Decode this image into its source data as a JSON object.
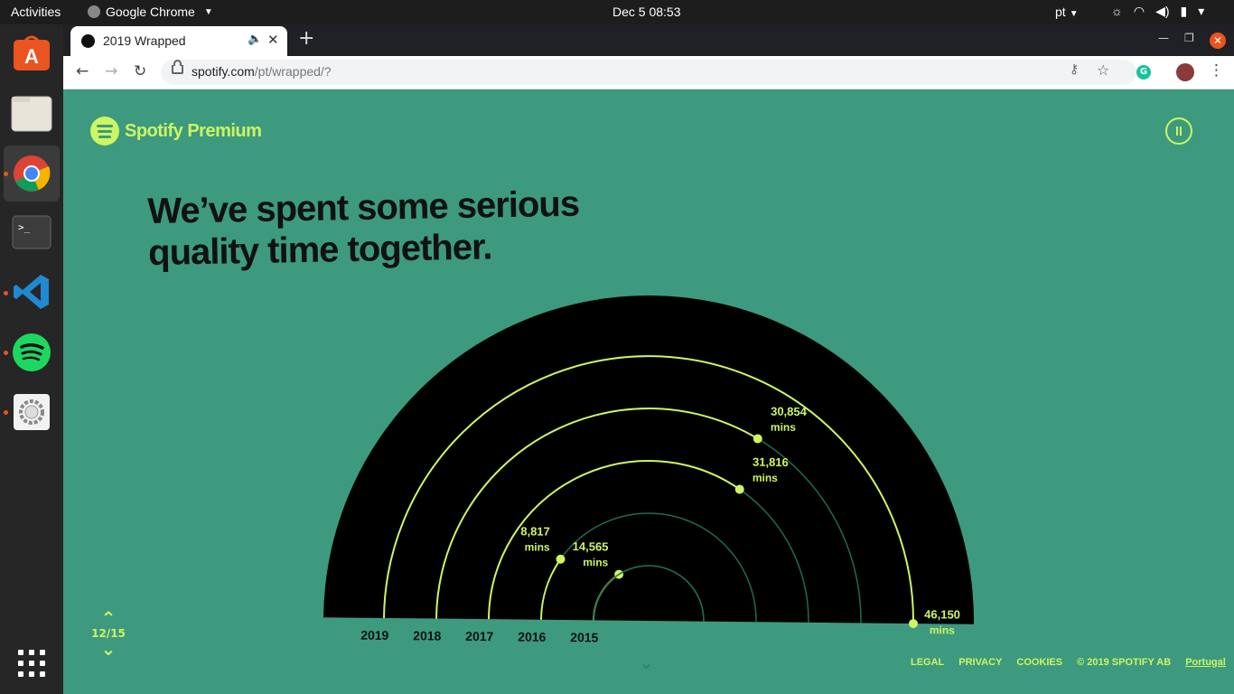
{
  "system_bar": {
    "activities": "Activities",
    "app_name": "Google Chrome",
    "clock": "Dec 5  08:53",
    "input_lang": "pt"
  },
  "dock": {
    "apps": [
      {
        "name": "Ubuntu Software",
        "icon": "software-store-icon",
        "running": false
      },
      {
        "name": "Files",
        "icon": "files-icon",
        "running": false
      },
      {
        "name": "Google Chrome",
        "icon": "chrome-icon",
        "running": true
      },
      {
        "name": "Terminal",
        "icon": "terminal-icon",
        "running": false
      },
      {
        "name": "Visual Studio Code",
        "icon": "vscode-icon",
        "running": true
      },
      {
        "name": "Spotify",
        "icon": "spotify-icon",
        "running": true
      },
      {
        "name": "Settings",
        "icon": "settings-icon",
        "running": true
      }
    ]
  },
  "browser": {
    "tab_title": "2019 Wrapped",
    "url_host": "spotify.com",
    "url_path": "/pt/wrapped/?"
  },
  "page": {
    "brand": "Spotify Premium",
    "headline_line1": "We’ve spent some serious",
    "headline_line2": "quality time together.",
    "pager": "12/15",
    "footer": {
      "legal": "LEGAL",
      "privacy": "PRIVACY",
      "cookies": "COOKIES",
      "copyright": "© 2019 SPOTIFY AB",
      "country": "Portugal"
    }
  },
  "chart_data": {
    "type": "radial",
    "categories": [
      "2019",
      "2018",
      "2017",
      "2016",
      "2015"
    ],
    "values": [
      46150,
      30854,
      31816,
      8817,
      14565
    ],
    "unit": "mins",
    "labels": [
      "46,150",
      "30,854",
      "31,816",
      "8,817",
      "14,565"
    ]
  },
  "colors": {
    "background": "#3d9a7e",
    "accent": "#cdf564",
    "arc_track": "#1f6b55",
    "chart_bg": "#000000"
  }
}
